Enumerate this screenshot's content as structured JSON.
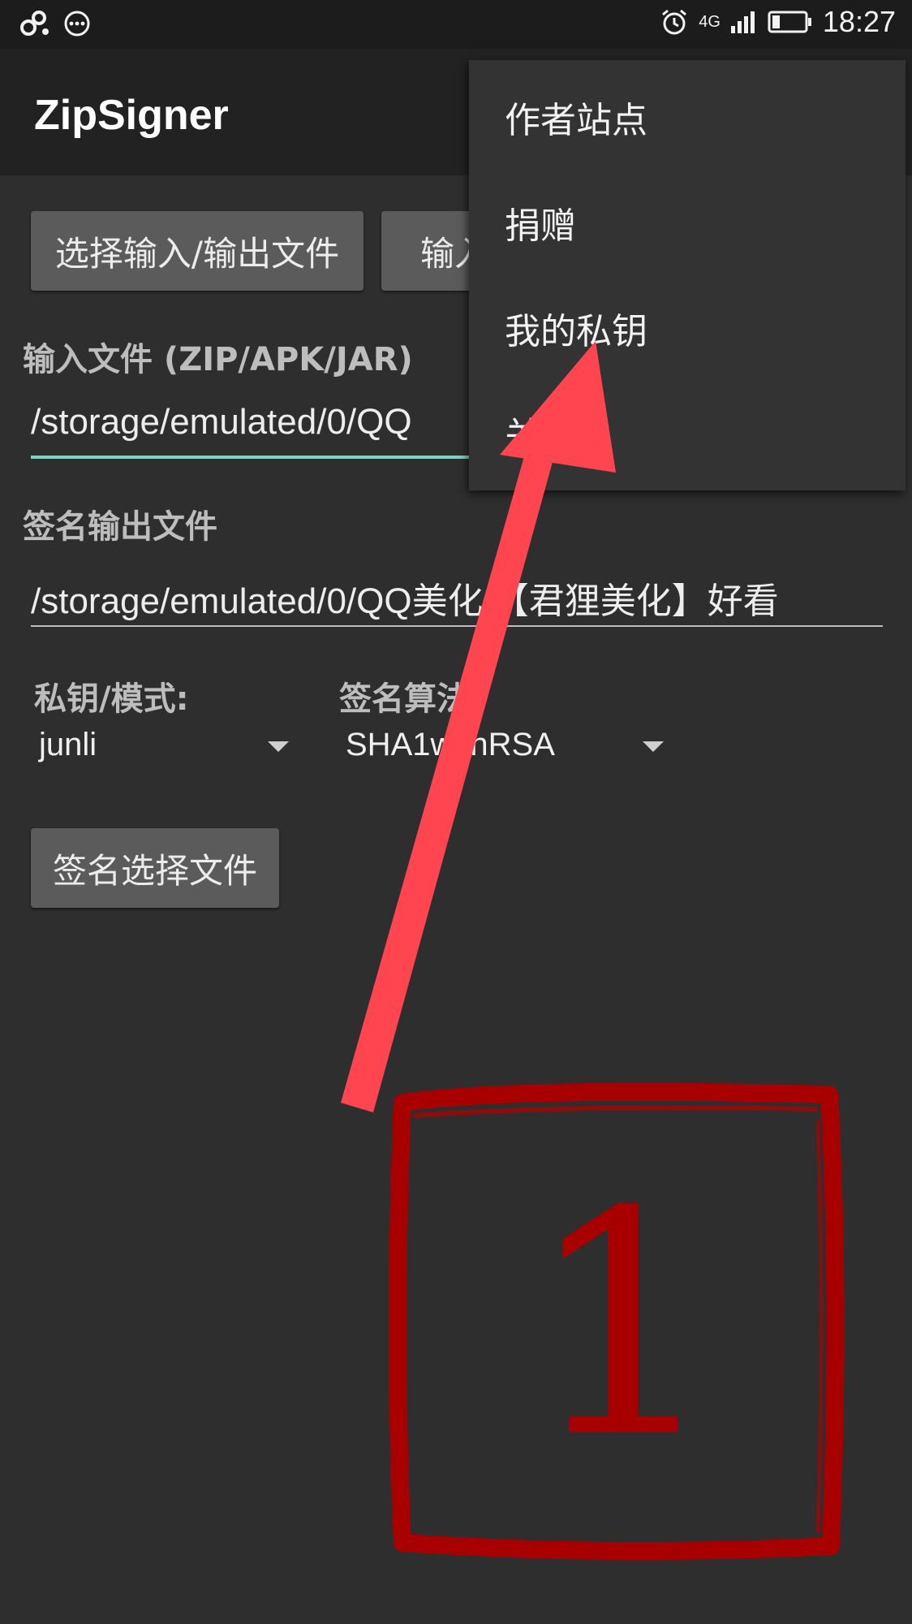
{
  "status_bar": {
    "time": "18:27",
    "network": "4G",
    "icons": [
      "link-icon",
      "message-icon",
      "alarm-icon",
      "signal-icon",
      "battery-icon"
    ]
  },
  "app_bar": {
    "title": "ZipSigner"
  },
  "buttons": {
    "select_io": "选择输入/输出文件",
    "output_partial": "输入",
    "sign_select": "签名选择文件"
  },
  "fields": {
    "input_label": "输入文件 (ZIP/APK/JAR)",
    "input_value": "/storage/emulated/0/QQ",
    "output_label": "签名输出文件",
    "output_value": "/storage/emulated/0/QQ美化/【君狸美化】好看"
  },
  "spinners": {
    "key_label": "私钥/模式:",
    "key_value": "junli",
    "algo_label": "签名算法",
    "algo_value": "SHA1withRSA"
  },
  "overflow_menu": {
    "items": [
      "作者站点",
      "捐赠",
      "我的私钥",
      "关于"
    ]
  },
  "annotation": {
    "step_number": "1",
    "arrow_color": "#ff4550",
    "stamp_color": "#a80000"
  }
}
